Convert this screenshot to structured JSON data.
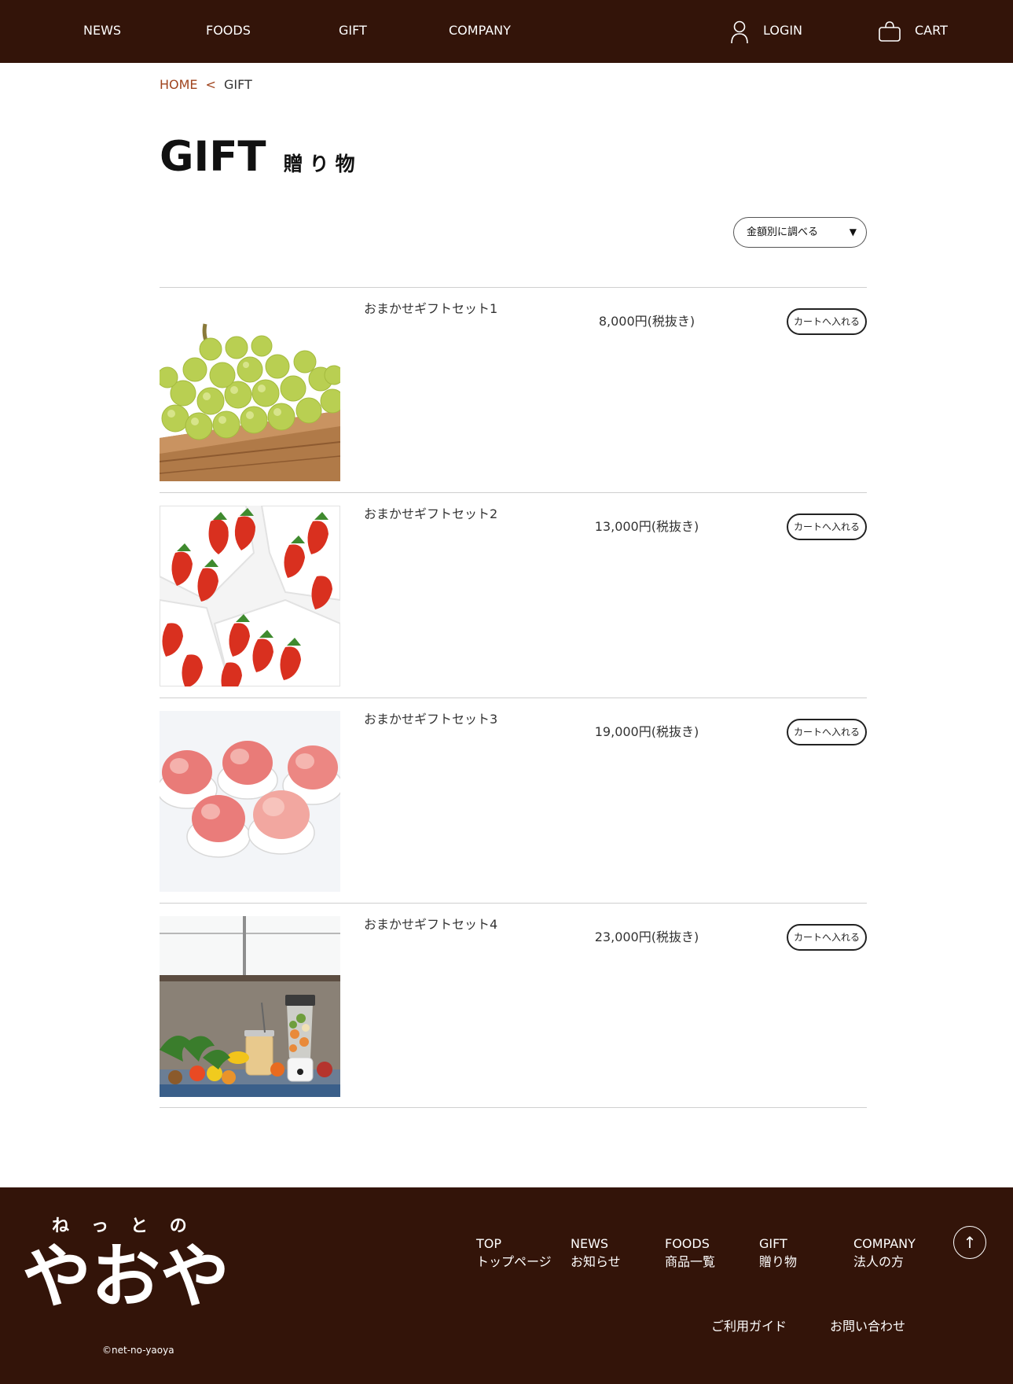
{
  "header": {
    "nav": [
      "NEWS",
      "FOODS",
      "GIFT",
      "COMPANY"
    ],
    "login_label": "LOGIN",
    "cart_label": "CART",
    "background": "#331409"
  },
  "breadcrumb": {
    "home": "HOME",
    "separator": "<",
    "current": "GIFT"
  },
  "page_title": {
    "en": "GIFT",
    "jp": "贈り物"
  },
  "filter": {
    "selected": "金額別に調べる"
  },
  "products": [
    {
      "name": "おまかせギフトセット1",
      "price": "8,000円(税抜き)",
      "button": "カートへ入れる",
      "image": "grapes"
    },
    {
      "name": "おまかせギフトセット2",
      "price": "13,000円(税抜き)",
      "button": "カートへ入れる",
      "image": "strawberries"
    },
    {
      "name": "おまかせギフトセット3",
      "price": "19,000円(税抜き)",
      "button": "カートへ入れる",
      "image": "peaches"
    },
    {
      "name": "おまかせギフトセット4",
      "price": "23,000円(税抜き)",
      "button": "カートへ入れる",
      "image": "smoothie-blender"
    }
  ],
  "footer": {
    "logo_small": "ねっとの",
    "logo_large": "やおや",
    "copyright": "©net-no-yaoya",
    "nav": [
      {
        "en": "TOP",
        "jp": "トップページ"
      },
      {
        "en": "NEWS",
        "jp": "お知らせ"
      },
      {
        "en": "FOODS",
        "jp": "商品一覧"
      },
      {
        "en": "GIFT",
        "jp": "贈り物"
      },
      {
        "en": "COMPANY",
        "jp": "法人の方"
      }
    ],
    "scroll_top": "↑",
    "guide": "ご利用ガイド",
    "contact": "お問い合わせ"
  }
}
